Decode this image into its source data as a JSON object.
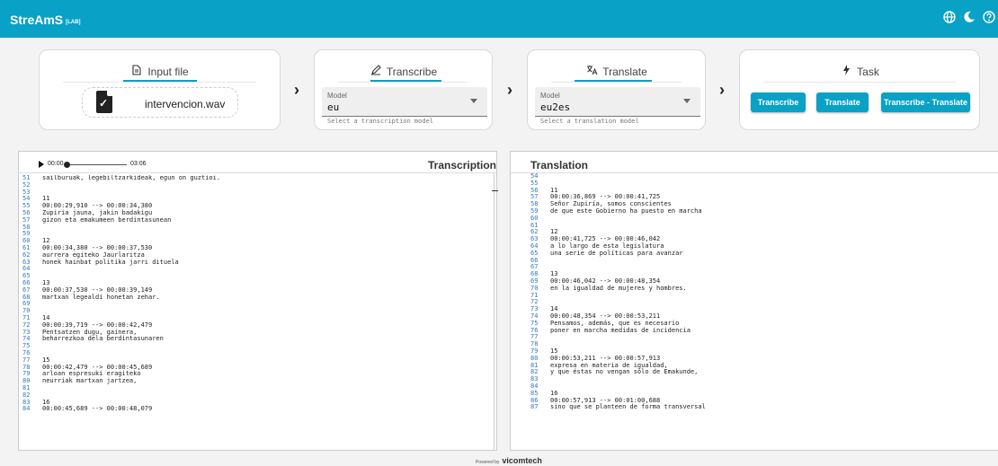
{
  "app": {
    "title": "StreAmS",
    "tag": "[LAB]"
  },
  "header_icons": [
    "globe-icon",
    "moon-icon",
    "help-icon"
  ],
  "input_card": {
    "title": "Input file",
    "icon": "file-icon",
    "file_name": "intervencion.wav"
  },
  "transcribe_card": {
    "title": "Transcribe",
    "icon": "pen-icon",
    "select_label": "Model",
    "select_value": "eu",
    "helper": "Select a transcription model"
  },
  "translate_card": {
    "title": "Translate",
    "icon": "translate-icon",
    "select_label": "Model",
    "select_value": "eu2es",
    "helper": "Select a translation model"
  },
  "task_card": {
    "title": "Task",
    "icon": "bolt-icon",
    "buttons": [
      "Transcribe",
      "Translate",
      "Transcribe - Translate"
    ]
  },
  "player": {
    "current": "00:00",
    "duration": "03:06",
    "progress": 0.0
  },
  "transcription": {
    "title": "Transcription",
    "lines": [
      [
        "51",
        "sailburuak, legebiltzarkideak, egun on guztioi."
      ],
      [
        "52",
        ""
      ],
      [
        "53",
        ""
      ],
      [
        "54",
        "11"
      ],
      [
        "55",
        "00:00:29,910 --> 00:00:34,380"
      ],
      [
        "56",
        "Zupiria jauna, jakin badakigu"
      ],
      [
        "57",
        "gizon eta emakumeen berdintasunean"
      ],
      [
        "58",
        ""
      ],
      [
        "59",
        ""
      ],
      [
        "60",
        "12"
      ],
      [
        "61",
        "00:00:34,380 --> 00:00:37,530"
      ],
      [
        "62",
        "aurrera egiteko Jaurlaritza"
      ],
      [
        "63",
        "honek hainbat politika jarri dituela"
      ],
      [
        "64",
        ""
      ],
      [
        "65",
        ""
      ],
      [
        "66",
        "13"
      ],
      [
        "67",
        "00:00:37,530 --> 00:00:39,149"
      ],
      [
        "68",
        "martxan legealdi honetan zehar."
      ],
      [
        "69",
        ""
      ],
      [
        "70",
        ""
      ],
      [
        "71",
        "14"
      ],
      [
        "72",
        "00:00:39,719 --> 00:00:42,479"
      ],
      [
        "73",
        "Pentsatzen dugu, gainera,"
      ],
      [
        "74",
        "beharrezkoa dela berdintasunaren"
      ],
      [
        "75",
        ""
      ],
      [
        "76",
        ""
      ],
      [
        "77",
        "15"
      ],
      [
        "78",
        "00:00:42,479 --> 00:00:45,689"
      ],
      [
        "79",
        "arloan espresuki eragiteko"
      ],
      [
        "80",
        "neurriak martxan jartzea,"
      ],
      [
        "81",
        ""
      ],
      [
        "82",
        ""
      ],
      [
        "83",
        "16"
      ],
      [
        "84",
        "00:00:45,689 --> 00:00:48,079"
      ]
    ]
  },
  "translation": {
    "title": "Translation",
    "lines": [
      [
        "54",
        ""
      ],
      [
        "55",
        ""
      ],
      [
        "56",
        "11"
      ],
      [
        "57",
        "00:00:36,869 --> 00:00:41,725"
      ],
      [
        "58",
        "Señor Zupiría, somos conscientes"
      ],
      [
        "59",
        "de que este Gobierno ha puesto en marcha"
      ],
      [
        "60",
        ""
      ],
      [
        "61",
        ""
      ],
      [
        "62",
        "12"
      ],
      [
        "63",
        "00:00:41,725 --> 00:00:46,042"
      ],
      [
        "64",
        "a lo largo de esta legislatura"
      ],
      [
        "65",
        "una serie de políticas para avanzar"
      ],
      [
        "66",
        ""
      ],
      [
        "67",
        ""
      ],
      [
        "68",
        "13"
      ],
      [
        "69",
        "00:00:46,042 --> 00:00:48,354"
      ],
      [
        "70",
        "en la igualdad de mujeres y hombres."
      ],
      [
        "71",
        ""
      ],
      [
        "72",
        ""
      ],
      [
        "73",
        "14"
      ],
      [
        "74",
        "00:00:48,354 --> 00:00:53,211"
      ],
      [
        "75",
        "Pensamos, además, que es necesario"
      ],
      [
        "76",
        "poner en marcha medidas de incidencia"
      ],
      [
        "77",
        ""
      ],
      [
        "78",
        ""
      ],
      [
        "79",
        "15"
      ],
      [
        "80",
        "00:00:53,211 --> 00:00:57,913"
      ],
      [
        "81",
        "expresa en materia de igualdad,"
      ],
      [
        "82",
        "y que éstas no vengan sólo de Emakunde,"
      ],
      [
        "83",
        ""
      ],
      [
        "84",
        ""
      ],
      [
        "85",
        "16"
      ],
      [
        "86",
        "00:00:57,913 --> 00:01:00,688"
      ],
      [
        "87",
        "sino que se planteen de forma transversal"
      ]
    ]
  },
  "footer": {
    "powered": "Powered by",
    "company": "vicomtech"
  },
  "colors": {
    "accent": "#0aa1c6"
  }
}
